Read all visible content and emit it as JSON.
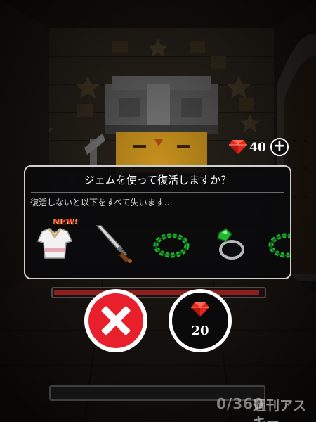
{
  "hud": {
    "gem_count": "40",
    "add_label": "+"
  },
  "dialog": {
    "title": "ジェムを使って復活しますか？",
    "subtitle": "復活しないと以下をすべて失います…",
    "items": [
      {
        "icon": "white-tunic-icon",
        "badge": "NEW!"
      },
      {
        "icon": "sword-icon"
      },
      {
        "icon": "green-wreath-icon"
      },
      {
        "icon": "emerald-ring-icon"
      },
      {
        "icon": "green-wreath-icon"
      }
    ]
  },
  "actions": {
    "cancel_icon": "close-icon",
    "revive_cost": "20",
    "revive_icon": "red-gem-icon"
  },
  "progress": {
    "text": "0/360",
    "value": 0
  },
  "health": {
    "fraction": 0.98
  },
  "watermark": "週刊アスキー",
  "colors": {
    "cancel": "#e8202b",
    "gem": "#e3271b",
    "item_green": "#1fb52d"
  }
}
